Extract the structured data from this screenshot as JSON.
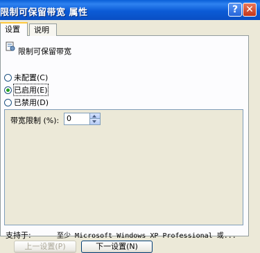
{
  "window": {
    "title": "限制可保留带宽 属性",
    "help_glyph": "?",
    "close_glyph": "✕"
  },
  "tabs": [
    {
      "label": "设置",
      "active": true
    },
    {
      "label": "说明",
      "active": false
    }
  ],
  "policy": {
    "icon": "policy-settings-icon",
    "title": "限制可保留带宽"
  },
  "options": [
    {
      "label": "未配置(C)",
      "checked": false
    },
    {
      "label": "已启用(E)",
      "checked": true
    },
    {
      "label": "已禁用(D)",
      "checked": false
    }
  ],
  "bandwidth": {
    "label": "带宽限制 (%):",
    "value": "0"
  },
  "support": {
    "label": "支持于:",
    "value": "至少 Microsoft Windows XP Professional 或..."
  },
  "buttons": {
    "prev": "上一设置(P)",
    "next": "下一设置(N)"
  },
  "colors": {
    "titlebar": "#0A5FD8",
    "dialog_bg": "#ECE9D8",
    "radio_check": "#21A121"
  }
}
